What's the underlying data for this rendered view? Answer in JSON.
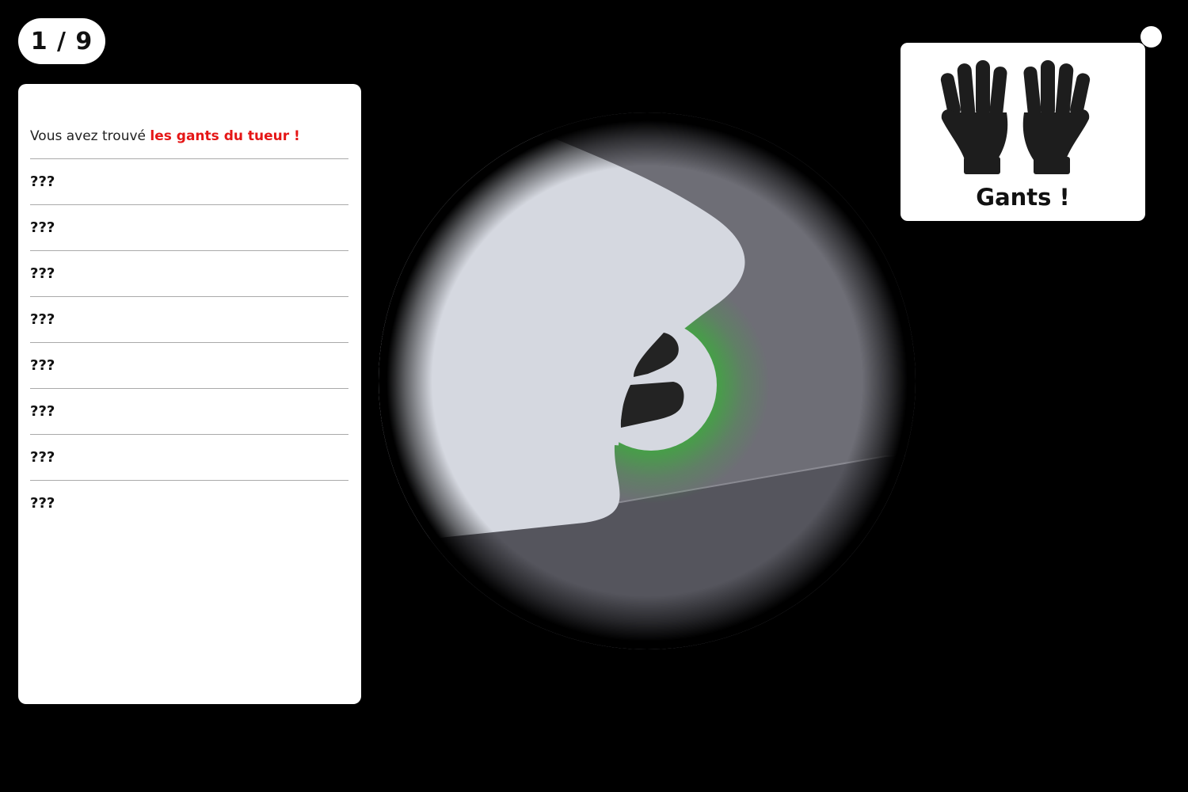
{
  "counter": {
    "text": "1 / 9"
  },
  "panel": {
    "found_prefix": "Vous avez trouvé ",
    "found_highlight": "les gants du tueur !",
    "clues": [
      "???",
      "???",
      "???",
      "???",
      "???",
      "???",
      "???",
      "???"
    ]
  },
  "card": {
    "icon": "gloves-icon",
    "label": "Gants !"
  },
  "colors": {
    "highlight": "#e51616",
    "found_glow": "#3fa83f",
    "background": "#000000"
  }
}
